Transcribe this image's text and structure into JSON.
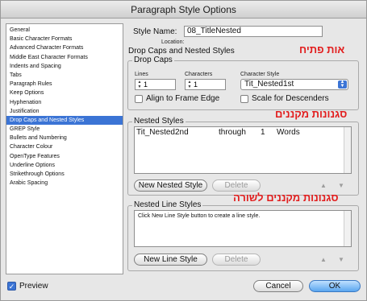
{
  "window": {
    "title": "Paragraph Style Options"
  },
  "sidebar": {
    "items": [
      "General",
      "Basic Character Formats",
      "Advanced Character Formats",
      "Middle East Character Formats",
      "Indents and Spacing",
      "Tabs",
      "Paragraph Rules",
      "Keep Options",
      "Hyphenation",
      "Justification",
      "Drop Caps and Nested Styles",
      "GREP Style",
      "Bullets and Numbering",
      "Character Colour",
      "OpenType Features",
      "Underline Options",
      "Strikethrough Options",
      "Arabic Spacing"
    ],
    "selected": "Drop Caps and Nested Styles"
  },
  "header": {
    "style_name_label": "Style Name:",
    "style_name_value": "08_TitleNested",
    "location_label": "Location:",
    "section_title": "Drop Caps and Nested Styles"
  },
  "annotations": {
    "drop_caps_he": "אות פתיח",
    "nested_styles_he": "סגנונות מקננים",
    "nested_line_styles_he": "סגנונות מקננים לשורה"
  },
  "drop_caps": {
    "title": "Drop Caps",
    "lines_label": "Lines",
    "lines_value": "1",
    "characters_label": "Characters",
    "characters_value": "1",
    "character_style_label": "Character Style",
    "character_style_value": "Tit_Nested1st",
    "align_label": "Align to Frame Edge",
    "scale_label": "Scale for Descenders"
  },
  "nested_styles": {
    "title": "Nested Styles",
    "rows": [
      {
        "style": "Tit_Nested2nd",
        "through": "through",
        "count": "1",
        "unit": "Words"
      }
    ],
    "new_button": "New Nested Style",
    "delete_button": "Delete"
  },
  "nested_line_styles": {
    "title": "Nested Line Styles",
    "hint": "Click New Line Style button to create a line style.",
    "new_button": "New Line Style",
    "delete_button": "Delete"
  },
  "footer": {
    "preview_label": "Preview",
    "cancel_label": "Cancel",
    "ok_label": "OK"
  },
  "colors": {
    "selection": "#3b74d5",
    "annotation": "#e21d1d"
  }
}
